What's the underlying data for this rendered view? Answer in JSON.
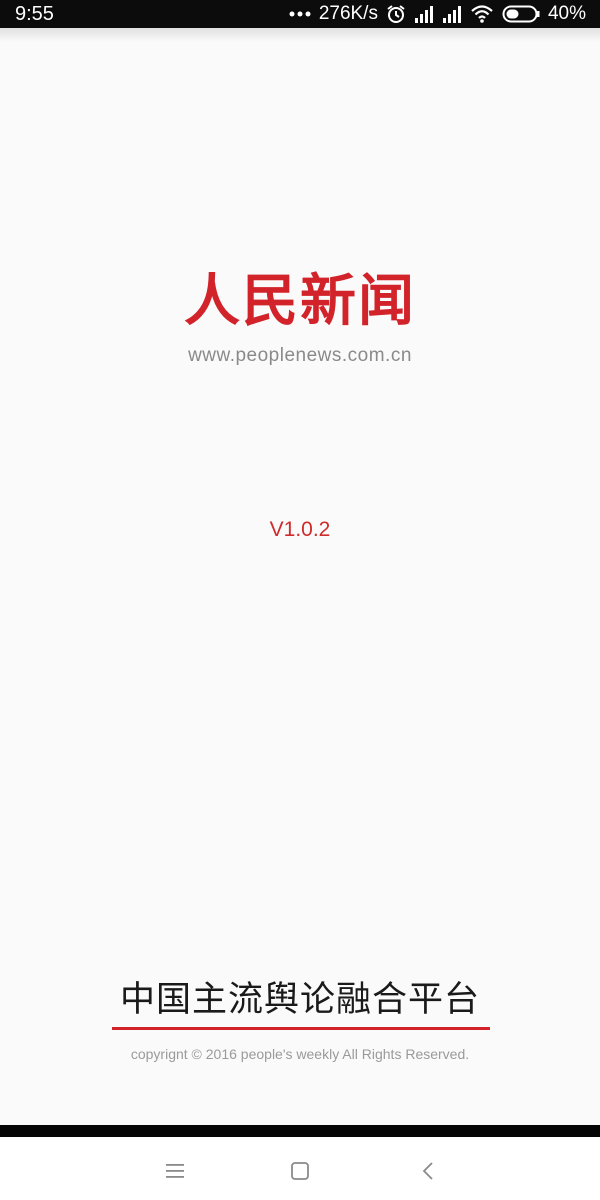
{
  "status_bar": {
    "time": "9:55",
    "more_icon": "more-dots-icon",
    "network_speed": "276K/s",
    "battery_percent": "40%",
    "icons": [
      "alarm-icon",
      "signal-icon",
      "signal-icon",
      "wifi-icon",
      "battery-icon"
    ]
  },
  "logo": {
    "title": "人民新闻",
    "url": "www.peoplenews.com.cn"
  },
  "version": {
    "label": "V1.0.2"
  },
  "footer": {
    "slogan": "中国主流舆论融合平台",
    "copyright": "copyrignt © 2016 people's weekly All Rights Reserved."
  },
  "nav_bar": {
    "icons": [
      "menu-icon",
      "home-icon",
      "back-icon"
    ]
  },
  "colors": {
    "brand_red": "#d2232a",
    "background": "#fafafa",
    "status_bar": "#0c0c0c"
  }
}
